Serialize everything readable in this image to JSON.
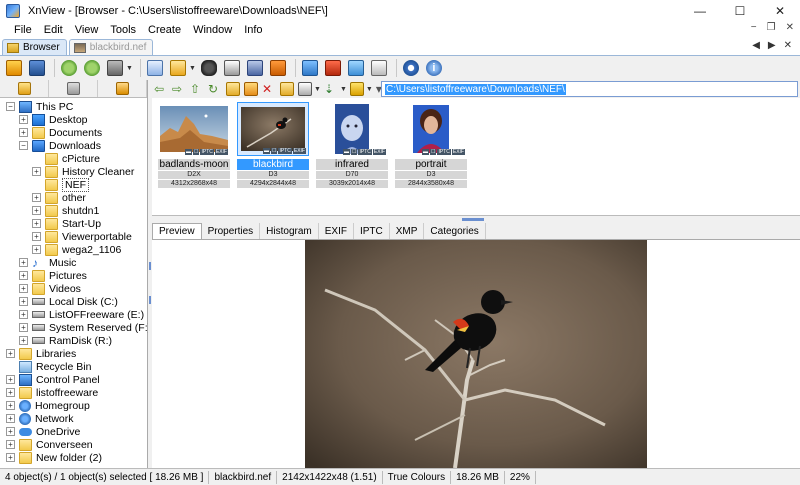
{
  "window": {
    "title": "XnView - [Browser - C:\\Users\\listoffreeware\\Downloads\\NEF\\]",
    "minimize": "—",
    "maximize": "☐",
    "close": "✕"
  },
  "menu": {
    "items": [
      "File",
      "Edit",
      "View",
      "Tools",
      "Create",
      "Window",
      "Info"
    ],
    "right": [
      "−",
      "❐",
      "✕"
    ]
  },
  "tabs": [
    {
      "label": "Browser",
      "active": true
    },
    {
      "label": "blackbird.nef",
      "active": false
    }
  ],
  "tab_controls": [
    "◀",
    "▶",
    "✕"
  ],
  "address": {
    "value": "C:\\Users\\listoffreeware\\Downloads\\NEF\\"
  },
  "tree": [
    {
      "label": "This PC",
      "level": 0,
      "exp": "−",
      "icon": "pc"
    },
    {
      "label": "Desktop",
      "level": 1,
      "exp": "+",
      "icon": "desktop"
    },
    {
      "label": "Documents",
      "level": 1,
      "exp": "+",
      "icon": "folder"
    },
    {
      "label": "Downloads",
      "level": 1,
      "exp": "−",
      "icon": "download"
    },
    {
      "label": "cPicture",
      "level": 2,
      "exp": "",
      "icon": "folder"
    },
    {
      "label": "History Cleaner",
      "level": 2,
      "exp": "+",
      "icon": "folder"
    },
    {
      "label": "NEF",
      "level": 2,
      "exp": "",
      "icon": "folder",
      "selected": true
    },
    {
      "label": "other",
      "level": 2,
      "exp": "+",
      "icon": "folder"
    },
    {
      "label": "shutdn1",
      "level": 2,
      "exp": "+",
      "icon": "folder"
    },
    {
      "label": "Start-Up",
      "level": 2,
      "exp": "+",
      "icon": "folder"
    },
    {
      "label": "Viewerportable",
      "level": 2,
      "exp": "+",
      "icon": "folder"
    },
    {
      "label": "wega2_1106",
      "level": 2,
      "exp": "+",
      "icon": "folder"
    },
    {
      "label": "Music",
      "level": 1,
      "exp": "+",
      "icon": "music"
    },
    {
      "label": "Pictures",
      "level": 1,
      "exp": "+",
      "icon": "folder"
    },
    {
      "label": "Videos",
      "level": 1,
      "exp": "+",
      "icon": "folder"
    },
    {
      "label": "Local Disk (C:)",
      "level": 1,
      "exp": "+",
      "icon": "drive"
    },
    {
      "label": "ListOFFreeware (E:)",
      "level": 1,
      "exp": "+",
      "icon": "drive"
    },
    {
      "label": "System Reserved (F:)",
      "level": 1,
      "exp": "+",
      "icon": "drive"
    },
    {
      "label": "RamDisk (R:)",
      "level": 1,
      "exp": "+",
      "icon": "drive"
    },
    {
      "label": "Libraries",
      "level": 0,
      "exp": "+",
      "icon": "folder"
    },
    {
      "label": "Recycle Bin",
      "level": 0,
      "exp": "",
      "icon": "recycle"
    },
    {
      "label": "Control Panel",
      "level": 0,
      "exp": "+",
      "icon": "pc"
    },
    {
      "label": "listoffreeware",
      "level": 0,
      "exp": "+",
      "icon": "folder"
    },
    {
      "label": "Homegroup",
      "level": 0,
      "exp": "+",
      "icon": "net"
    },
    {
      "label": "Network",
      "level": 0,
      "exp": "+",
      "icon": "net"
    },
    {
      "label": "OneDrive",
      "level": 0,
      "exp": "+",
      "icon": "cloud"
    },
    {
      "label": "Converseen",
      "level": 0,
      "exp": "+",
      "icon": "folder"
    },
    {
      "label": "New folder (2)",
      "level": 0,
      "exp": "+",
      "icon": "folder"
    }
  ],
  "thumbnails": [
    {
      "name": "badlands-moon",
      "camera": "D2X",
      "size": "4312x2868x48",
      "selected": false
    },
    {
      "name": "blackbird",
      "camera": "D3",
      "size": "4294x2844x48",
      "selected": true
    },
    {
      "name": "infrared",
      "camera": "D70",
      "size": "3039x2014x48",
      "selected": false
    },
    {
      "name": "portrait",
      "camera": "D3",
      "size": "2844x3580x48",
      "selected": false
    }
  ],
  "badges": [
    "▬",
    "☐",
    "IPTC",
    "EXIF"
  ],
  "preview_tabs": [
    "Preview",
    "Properties",
    "Histogram",
    "EXIF",
    "IPTC",
    "XMP",
    "Categories"
  ],
  "status": [
    "4 object(s) / 1 object(s) selected  [ 18.26 MB ]",
    "blackbird.nef",
    "2142x1422x48 (1.51)",
    "True Colours",
    "18.26 MB",
    "22%"
  ]
}
